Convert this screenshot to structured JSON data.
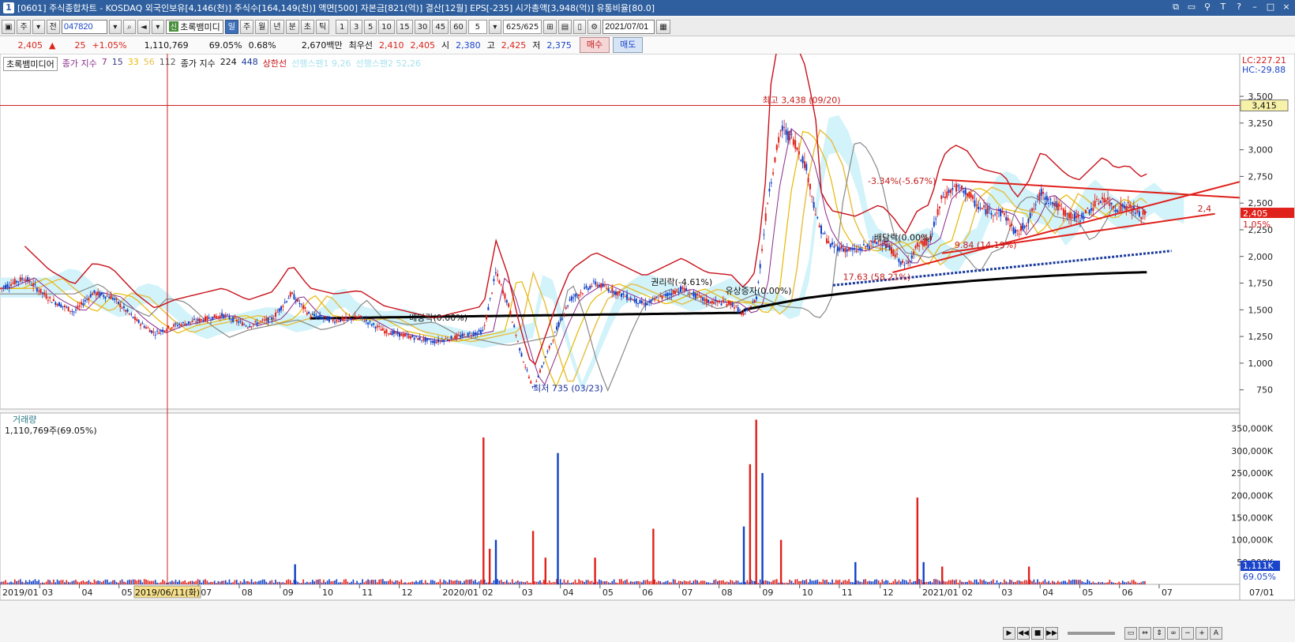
{
  "title_bar": {
    "window_num": "1",
    "text": "[0601] 주식종합차트 - KOSDAQ 외국인보유[4,146(천)] 주식수[164,149(천)] 액면[500] 자본금[821(억)] 결산[12월] EPS[-235] 시가총액[3,948(억)] 유통비율[80.0]",
    "icons": [
      "layout-icon",
      "window-icon",
      "pin-icon",
      "text-icon",
      "help-icon",
      "minimize-icon",
      "maximize-icon",
      "close-icon"
    ]
  },
  "toolbar": {
    "code": "047820",
    "labels": [
      "주",
      "전"
    ],
    "stock_name": "초록뱀미디",
    "shin": "신",
    "periods": [
      "일",
      "주",
      "월",
      "년",
      "분",
      "초",
      "틱"
    ],
    "active_period": "일",
    "intervals": [
      "1",
      "3",
      "5",
      "10",
      "15",
      "30",
      "45",
      "60"
    ],
    "interval_value": "5",
    "count": "625",
    "total": "/625",
    "date": "2021/07/01"
  },
  "info_bar": {
    "price": "2,405",
    "arrow": "▲",
    "change": "25",
    "change_pct": "+1.05%",
    "volume": "1,110,769",
    "volume_pct": "69.05%",
    "turnover": "0.68%",
    "amount": "2,670백만",
    "priority_label": "최우선",
    "ask": "2,410",
    "bid": "2,405",
    "open_label": "시",
    "open": "2,380",
    "high_label": "고",
    "high": "2,425",
    "low_label": "저",
    "low": "2,375",
    "buy": "매수",
    "sell": "매도"
  },
  "legend": {
    "name": "초록뱀미디어",
    "close_label": "종가 지수",
    "ma": [
      "7",
      "15",
      "33",
      "56",
      "112"
    ],
    "ma_colors": [
      "#8a2b8a",
      "#3a3a8a",
      "#e6b800",
      "#e8c04a",
      "#555555"
    ],
    "close_label2": "종가 지수",
    "ma2": [
      "224",
      "448"
    ],
    "ma2_colors": [
      "#000000",
      "#1a3a9c"
    ],
    "upper_line": "상한선",
    "ichimoku1": "선행스팬1 9,26",
    "ichimoku2": "선행스팬2 52,26"
  },
  "colors": {
    "up": "#e0201a",
    "down": "#1040c8",
    "cloud": "#c5f0f8",
    "bollinger": "#c8101a",
    "ma224": "#000000",
    "ma448": "#1a3a9c"
  },
  "chart_data": {
    "type": "candlestick",
    "start": "2019-01",
    "end": "2021-07",
    "price_axis": {
      "ticks": [
        "3,500",
        "3,250",
        "3,000",
        "2,750",
        "2,500",
        "2,250",
        "2,000",
        "1,750",
        "1,500",
        "1,250",
        "1,000",
        "750"
      ],
      "ylim": [
        570,
        3900
      ]
    },
    "volume_axis": {
      "ticks": [
        "350,000K",
        "300,000K",
        "250,000K",
        "200,000K",
        "150,000K",
        "100,000K",
        "50,000K"
      ],
      "ylim": [
        0,
        385000
      ]
    },
    "lc": "LC:227.21",
    "hc": "HC:-29.88",
    "current_price_label": "2,405",
    "current_pct_label": "1.05%",
    "horizontal_line_price": 3415,
    "horizontal_line_label": "3,415",
    "cursor_date_label": "2019/06/11(화)",
    "volume_title": "거래량",
    "volume_value": "1,110,769주(69.05%)",
    "volume_current_label": "1,111K",
    "volume_pct_label": "69.05%",
    "x_labels": [
      {
        "t": 0.0,
        "label": "2019/01"
      },
      {
        "t": 0.032,
        "label": "03"
      },
      {
        "t": 0.064,
        "label": "04"
      },
      {
        "t": 0.096,
        "label": "05"
      },
      {
        "t": 0.16,
        "label": "07"
      },
      {
        "t": 0.193,
        "label": "08"
      },
      {
        "t": 0.226,
        "label": "09"
      },
      {
        "t": 0.258,
        "label": "10"
      },
      {
        "t": 0.29,
        "label": "11"
      },
      {
        "t": 0.322,
        "label": "12"
      },
      {
        "t": 0.355,
        "label": "2020/01"
      },
      {
        "t": 0.387,
        "label": "02"
      },
      {
        "t": 0.419,
        "label": "03"
      },
      {
        "t": 0.452,
        "label": "04"
      },
      {
        "t": 0.484,
        "label": "05"
      },
      {
        "t": 0.516,
        "label": "06"
      },
      {
        "t": 0.548,
        "label": "07"
      },
      {
        "t": 0.58,
        "label": "08"
      },
      {
        "t": 0.613,
        "label": "09"
      },
      {
        "t": 0.645,
        "label": "10"
      },
      {
        "t": 0.677,
        "label": "11"
      },
      {
        "t": 0.71,
        "label": "12"
      },
      {
        "t": 0.742,
        "label": "2021/01"
      },
      {
        "t": 0.774,
        "label": "02"
      },
      {
        "t": 0.806,
        "label": "03"
      },
      {
        "t": 0.839,
        "label": "04"
      },
      {
        "t": 0.871,
        "label": "05"
      },
      {
        "t": 0.903,
        "label": "06"
      },
      {
        "t": 0.935,
        "label": "07"
      }
    ],
    "right_date_label": "07/01",
    "price_path": [
      [
        0.0,
        1700
      ],
      [
        0.02,
        1800
      ],
      [
        0.04,
        1600
      ],
      [
        0.06,
        1480
      ],
      [
        0.075,
        1660
      ],
      [
        0.09,
        1620
      ],
      [
        0.11,
        1400
      ],
      [
        0.125,
        1280
      ],
      [
        0.14,
        1350
      ],
      [
        0.16,
        1400
      ],
      [
        0.18,
        1450
      ],
      [
        0.2,
        1350
      ],
      [
        0.22,
        1420
      ],
      [
        0.235,
        1650
      ],
      [
        0.25,
        1450
      ],
      [
        0.27,
        1400
      ],
      [
        0.29,
        1430
      ],
      [
        0.31,
        1300
      ],
      [
        0.33,
        1250
      ],
      [
        0.35,
        1200
      ],
      [
        0.37,
        1250
      ],
      [
        0.39,
        1300
      ],
      [
        0.4,
        1850
      ],
      [
        0.41,
        1550
      ],
      [
        0.42,
        1100
      ],
      [
        0.43,
        760
      ],
      [
        0.44,
        1050
      ],
      [
        0.45,
        1350
      ],
      [
        0.46,
        1600
      ],
      [
        0.48,
        1750
      ],
      [
        0.5,
        1650
      ],
      [
        0.52,
        1550
      ],
      [
        0.53,
        1600
      ],
      [
        0.55,
        1700
      ],
      [
        0.57,
        1580
      ],
      [
        0.59,
        1560
      ],
      [
        0.6,
        1450
      ],
      [
        0.61,
        1600
      ],
      [
        0.62,
        2600
      ],
      [
        0.63,
        3200
      ],
      [
        0.64,
        3100
      ],
      [
        0.65,
        2850
      ],
      [
        0.66,
        2300
      ],
      [
        0.67,
        2100
      ],
      [
        0.69,
        2050
      ],
      [
        0.71,
        2150
      ],
      [
        0.72,
        2050
      ],
      [
        0.73,
        1900
      ],
      [
        0.74,
        2100
      ],
      [
        0.75,
        2150
      ],
      [
        0.76,
        2550
      ],
      [
        0.77,
        2650
      ],
      [
        0.78,
        2600
      ],
      [
        0.79,
        2450
      ],
      [
        0.81,
        2400
      ],
      [
        0.82,
        2200
      ],
      [
        0.83,
        2350
      ],
      [
        0.84,
        2600
      ],
      [
        0.85,
        2500
      ],
      [
        0.86,
        2400
      ],
      [
        0.87,
        2350
      ],
      [
        0.88,
        2450
      ],
      [
        0.89,
        2550
      ],
      [
        0.9,
        2450
      ],
      [
        0.91,
        2480
      ],
      [
        0.92,
        2380
      ],
      [
        0.925,
        2405
      ]
    ],
    "annotations": [
      {
        "text": "최고 3,438 (09/20)",
        "t": 0.615,
        "price": 3438,
        "color": "#c21b1b"
      },
      {
        "text": "최저 735 (03/23)",
        "t": 0.43,
        "price": 735,
        "color": "#1a2f9c"
      },
      {
        "text": "권리락(-4.61%)",
        "t": 0.525,
        "price": 1730,
        "color": "#111111"
      },
      {
        "text": "유상증자(0.00%)",
        "t": 0.585,
        "price": 1650,
        "color": "#111111"
      },
      {
        "text": "배당락(0.00%)",
        "t": 0.33,
        "price": 1400,
        "color": "#111111"
      },
      {
        "text": "배당락(0.00%)",
        "t": 0.705,
        "price": 2150,
        "color": "#111111"
      },
      {
        "text": "-3.34%(-5.67%)",
        "t": 0.7,
        "price": 2680,
        "color": "#c21b1b"
      },
      {
        "text": "9.84 (14.19%)",
        "t": 0.77,
        "price": 2080,
        "color": "#c21b1b"
      },
      {
        "text": "17.63 (58.21%)",
        "t": 0.68,
        "price": 1780,
        "color": "#c21b1b"
      },
      {
        "text": "2,4",
        "t": 0.966,
        "price": 2420,
        "color": "#c21b1b"
      }
    ],
    "trendlines": [
      {
        "from": [
          0.76,
          2720
        ],
        "to": [
          1.0,
          2550
        ]
      },
      {
        "from": [
          0.72,
          1850
        ],
        "to": [
          1.0,
          2700
        ]
      },
      {
        "from": [
          0.76,
          2030
        ],
        "to": [
          0.98,
          2400
        ]
      }
    ],
    "volume_spikes": [
      {
        "t": 0.238,
        "v": 45000
      },
      {
        "t": 0.39,
        "v": 330000
      },
      {
        "t": 0.395,
        "v": 80000
      },
      {
        "t": 0.4,
        "v": 100000
      },
      {
        "t": 0.43,
        "v": 120000
      },
      {
        "t": 0.44,
        "v": 60000
      },
      {
        "t": 0.45,
        "v": 295000
      },
      {
        "t": 0.48,
        "v": 60000
      },
      {
        "t": 0.527,
        "v": 125000
      },
      {
        "t": 0.6,
        "v": 130000
      },
      {
        "t": 0.605,
        "v": 270000
      },
      {
        "t": 0.61,
        "v": 370000
      },
      {
        "t": 0.615,
        "v": 250000
      },
      {
        "t": 0.63,
        "v": 100000
      },
      {
        "t": 0.74,
        "v": 195000
      },
      {
        "t": 0.745,
        "v": 50000
      },
      {
        "t": 0.76,
        "v": 40000
      },
      {
        "t": 0.83,
        "v": 40000
      },
      {
        "t": 0.69,
        "v": 50000
      }
    ]
  }
}
